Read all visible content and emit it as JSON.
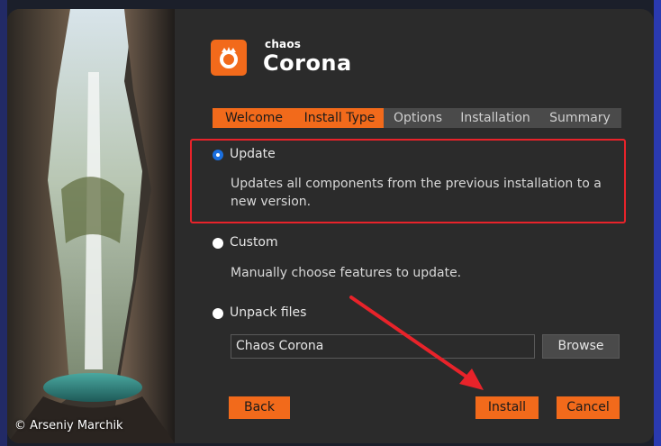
{
  "app": {
    "brand_small": "chaos",
    "brand_big": "Corona",
    "photo_credit": "© Arseniy Marchik"
  },
  "tabs": [
    {
      "label": "Welcome",
      "active": true
    },
    {
      "label": "Install Type",
      "active": true
    },
    {
      "label": "Options",
      "active": false
    },
    {
      "label": "Installation",
      "active": false
    },
    {
      "label": "Summary",
      "active": false
    }
  ],
  "options": {
    "update": {
      "label": "Update",
      "selected": true,
      "description": "Updates all components from the previous installation to a new version."
    },
    "custom": {
      "label": "Custom",
      "selected": false,
      "description": "Manually choose features to update."
    },
    "unpack": {
      "label": "Unpack files",
      "selected": false
    }
  },
  "unpack_path": {
    "value": "Chaos Corona"
  },
  "buttons": {
    "browse": "Browse",
    "back": "Back",
    "install": "Install",
    "cancel": "Cancel"
  },
  "colors": {
    "accent": "#f26a1b",
    "annotation": "#e8232a",
    "background": "#2b2b2b"
  }
}
